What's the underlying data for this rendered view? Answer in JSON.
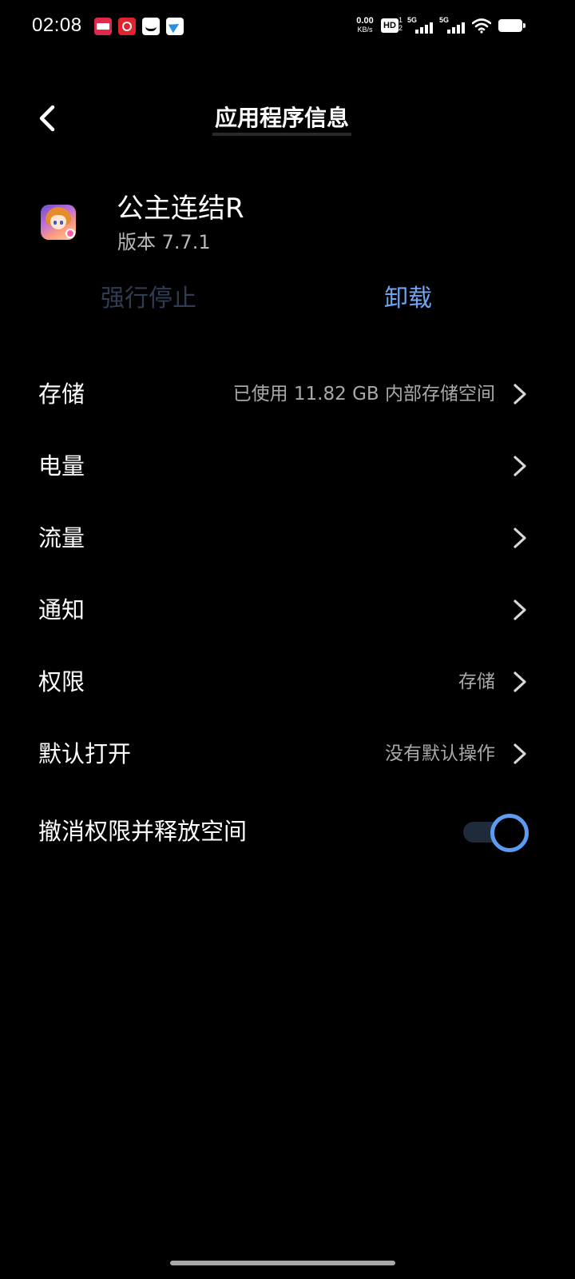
{
  "status_bar": {
    "time": "02:08",
    "net_speed_value": "0.00",
    "net_speed_unit": "KB/s",
    "hd_label": "HD",
    "hd_sub_top": "1",
    "hd_sub_bottom": "2",
    "sim1_label": "5G",
    "sim2_label": "5G",
    "notification_icons": [
      "bilibili-manga-icon",
      "netease-music-icon",
      "app-icon",
      "telegram-icon"
    ],
    "battery_level": 1.0
  },
  "header": {
    "back_icon": "chevron-left-icon",
    "title": "应用程序信息"
  },
  "app": {
    "name": "公主连结R",
    "version": "版本 7.7.1",
    "force_stop_label": "强行停止",
    "uninstall_label": "卸载"
  },
  "settings": {
    "storage": {
      "label": "存储",
      "value": "已使用 11.82 GB 内部存储空间"
    },
    "battery": {
      "label": "电量",
      "value": ""
    },
    "data_usage": {
      "label": "流量",
      "value": ""
    },
    "notifications": {
      "label": "通知",
      "value": ""
    },
    "permissions": {
      "label": "权限",
      "value": "存储"
    },
    "default_open": {
      "label": "默认打开",
      "value": "没有默认操作"
    },
    "revoke_permissions": {
      "label": "撤消权限并释放空间",
      "enabled": true
    }
  },
  "colors": {
    "background": "#000000",
    "accent": "#6fa4f0",
    "toggle_on": "#5b9bf0",
    "disabled_text": "#2f3c52",
    "secondary_text": "#a9a9a9"
  }
}
